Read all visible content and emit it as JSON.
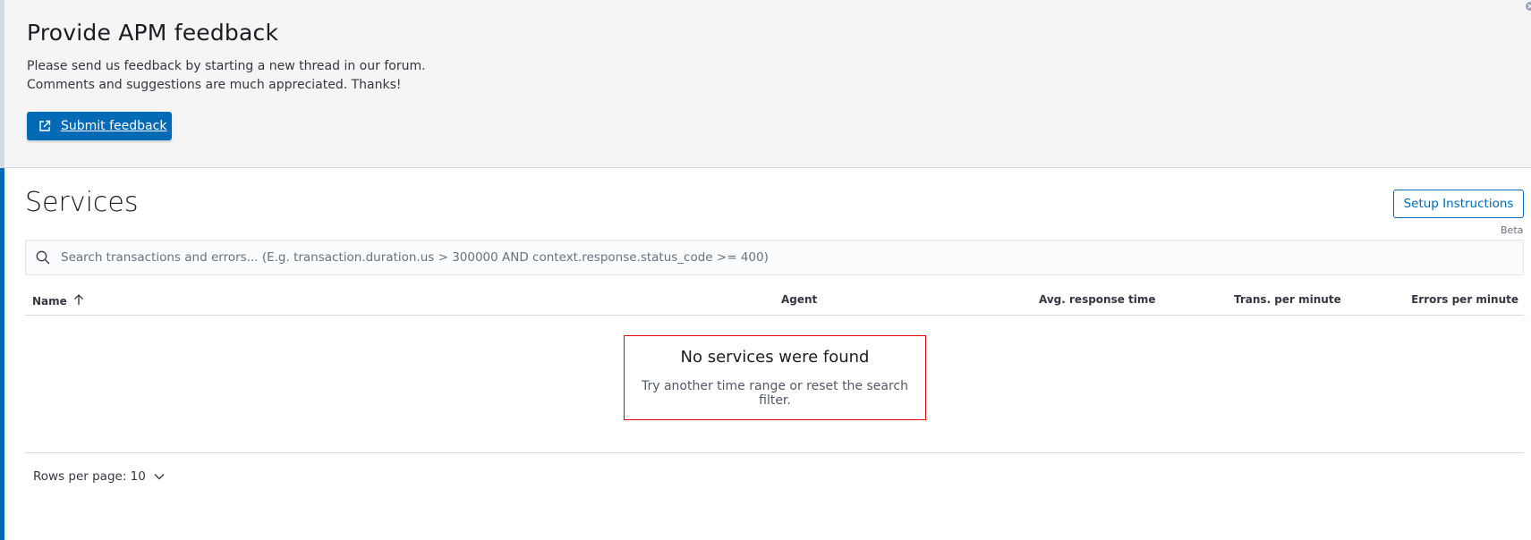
{
  "feedback": {
    "title": "Provide APM feedback",
    "line1": "Please send us feedback by starting a new thread in our forum.",
    "line2": "Comments and suggestions are much appreciated. Thanks!",
    "submit_label": "Submit feedback"
  },
  "services": {
    "title": "Services",
    "setup_label": "Setup Instructions",
    "beta_label": "Beta"
  },
  "search": {
    "placeholder": "Search transactions and errors... (E.g. transaction.duration.us > 300000 AND context.response.status_code >= 400)",
    "value": ""
  },
  "table": {
    "columns": [
      "Name",
      "Agent",
      "Avg. response time",
      "Trans. per minute",
      "Errors per minute"
    ],
    "sort_column": "Name",
    "sort_direction": "ascending"
  },
  "empty_state": {
    "title": "No services were found",
    "text": "Try another time range or reset the search filter."
  },
  "pagination": {
    "rows_per_page_label": "Rows per page: 10"
  },
  "colors": {
    "primary": "#006bb4",
    "empty_border": "#e7000b",
    "feedback_bg": "#f5f5f5"
  },
  "icons": {
    "submit": "external-link-icon",
    "search": "search-icon",
    "sort": "sort-up-icon",
    "rows": "chevron-down-icon"
  }
}
